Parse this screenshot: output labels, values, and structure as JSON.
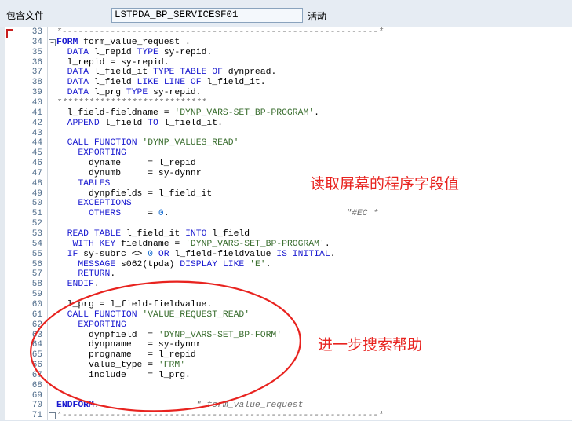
{
  "header": {
    "package_label": "包含文件",
    "include_name": "LSTPDA_BP_SERVICESF01",
    "status": "活动"
  },
  "annotations": {
    "read_screen_values": "读取屏幕的程序字段值",
    "search_help": "进一步搜索帮助"
  },
  "colors": {
    "annotation": "#e8231f",
    "keyword": "#1a1ad0",
    "string": "#3a6e2f",
    "line_number": "#4e6b8a"
  },
  "code_lines": [
    {
      "n": "33",
      "fold": "",
      "segs": [
        {
          "t": "*-----------------------------------------------------------*",
          "c": "cmt"
        }
      ]
    },
    {
      "n": "34",
      "fold": "⊟",
      "segs": [
        {
          "t": "FORM",
          "c": "kw bold"
        },
        {
          "t": " form_value_request .",
          "c": ""
        }
      ]
    },
    {
      "n": "35",
      "fold": "",
      "segs": [
        {
          "t": "  DATA",
          "c": "kw"
        },
        {
          "t": " l_repid ",
          "c": ""
        },
        {
          "t": "TYPE",
          "c": "kw"
        },
        {
          "t": " sy-repid.",
          "c": ""
        }
      ]
    },
    {
      "n": "36",
      "fold": "",
      "segs": [
        {
          "t": "  l_repid = sy-repid.",
          "c": ""
        }
      ]
    },
    {
      "n": "37",
      "fold": "",
      "segs": [
        {
          "t": "  DATA",
          "c": "kw"
        },
        {
          "t": " l_field_it ",
          "c": ""
        },
        {
          "t": "TYPE TABLE OF",
          "c": "kw"
        },
        {
          "t": " dynpread.",
          "c": ""
        }
      ]
    },
    {
      "n": "38",
      "fold": "",
      "segs": [
        {
          "t": "  DATA",
          "c": "kw"
        },
        {
          "t": " l_field ",
          "c": ""
        },
        {
          "t": "LIKE LINE OF",
          "c": "kw"
        },
        {
          "t": " l_field_it.",
          "c": ""
        }
      ]
    },
    {
      "n": "39",
      "fold": "",
      "segs": [
        {
          "t": "  DATA",
          "c": "kw"
        },
        {
          "t": " l_prg ",
          "c": ""
        },
        {
          "t": "TYPE",
          "c": "kw"
        },
        {
          "t": " sy-repid.",
          "c": ""
        }
      ]
    },
    {
      "n": "40",
      "fold": "",
      "segs": [
        {
          "t": "****************************",
          "c": "cmt"
        }
      ]
    },
    {
      "n": "41",
      "fold": "",
      "segs": [
        {
          "t": "  l_field-fieldname = ",
          "c": ""
        },
        {
          "t": "'DYNP_VARS-SET_BP-PROGRAM'",
          "c": "str"
        },
        {
          "t": ".",
          "c": ""
        }
      ]
    },
    {
      "n": "42",
      "fold": "",
      "segs": [
        {
          "t": "  APPEND",
          "c": "kw"
        },
        {
          "t": " l_field ",
          "c": ""
        },
        {
          "t": "TO",
          "c": "kw"
        },
        {
          "t": " l_field_it.",
          "c": ""
        }
      ]
    },
    {
      "n": "43",
      "fold": "",
      "segs": []
    },
    {
      "n": "44",
      "fold": "",
      "segs": [
        {
          "t": "  CALL FUNCTION",
          "c": "kw"
        },
        {
          "t": " ",
          "c": ""
        },
        {
          "t": "'DYNP_VALUES_READ'",
          "c": "str"
        }
      ]
    },
    {
      "n": "45",
      "fold": "",
      "segs": [
        {
          "t": "    EXPORTING",
          "c": "kw"
        }
      ]
    },
    {
      "n": "46",
      "fold": "",
      "segs": [
        {
          "t": "      dyname     = l_repid",
          "c": ""
        }
      ]
    },
    {
      "n": "47",
      "fold": "",
      "segs": [
        {
          "t": "      dynumb     = sy-dynnr",
          "c": ""
        }
      ]
    },
    {
      "n": "48",
      "fold": "",
      "segs": [
        {
          "t": "    TABLES",
          "c": "kw"
        }
      ]
    },
    {
      "n": "49",
      "fold": "",
      "segs": [
        {
          "t": "      dynpfields = l_field_it",
          "c": ""
        }
      ]
    },
    {
      "n": "50",
      "fold": "",
      "segs": [
        {
          "t": "    EXCEPTIONS",
          "c": "kw"
        }
      ]
    },
    {
      "n": "51",
      "fold": "",
      "segs": [
        {
          "t": "      OTHERS",
          "c": "kw"
        },
        {
          "t": "     = ",
          "c": ""
        },
        {
          "t": "0",
          "c": "num-lit"
        },
        {
          "t": ".                                 ",
          "c": ""
        },
        {
          "t": "\"#EC *",
          "c": "cmt"
        }
      ]
    },
    {
      "n": "52",
      "fold": "",
      "segs": []
    },
    {
      "n": "53",
      "fold": "",
      "segs": [
        {
          "t": "  READ TABLE",
          "c": "kw"
        },
        {
          "t": " l_field_it ",
          "c": ""
        },
        {
          "t": "INTO",
          "c": "kw"
        },
        {
          "t": " l_field",
          "c": ""
        }
      ]
    },
    {
      "n": "54",
      "fold": "",
      "segs": [
        {
          "t": "   WITH KEY",
          "c": "kw"
        },
        {
          "t": " fieldname = ",
          "c": ""
        },
        {
          "t": "'DYNP_VARS-SET_BP-PROGRAM'",
          "c": "str"
        },
        {
          "t": ".",
          "c": ""
        }
      ]
    },
    {
      "n": "55",
      "fold": "",
      "segs": [
        {
          "t": "  IF",
          "c": "kw"
        },
        {
          "t": " sy-subrc <> ",
          "c": ""
        },
        {
          "t": "0",
          "c": "num-lit"
        },
        {
          "t": " ",
          "c": ""
        },
        {
          "t": "OR",
          "c": "kw"
        },
        {
          "t": " l_field-fieldvalue ",
          "c": ""
        },
        {
          "t": "IS INITIAL",
          "c": "kw"
        },
        {
          "t": ".",
          "c": ""
        }
      ]
    },
    {
      "n": "56",
      "fold": "",
      "segs": [
        {
          "t": "    MESSAGE",
          "c": "kw"
        },
        {
          "t": " s062(tpda) ",
          "c": ""
        },
        {
          "t": "DISPLAY LIKE",
          "c": "kw"
        },
        {
          "t": " ",
          "c": ""
        },
        {
          "t": "'E'",
          "c": "str"
        },
        {
          "t": ".",
          "c": ""
        }
      ]
    },
    {
      "n": "57",
      "fold": "",
      "segs": [
        {
          "t": "    RETURN",
          "c": "kw"
        },
        {
          "t": ".",
          "c": ""
        }
      ]
    },
    {
      "n": "58",
      "fold": "",
      "segs": [
        {
          "t": "  ENDIF",
          "c": "kw"
        },
        {
          "t": ".",
          "c": ""
        }
      ]
    },
    {
      "n": "59",
      "fold": "",
      "segs": []
    },
    {
      "n": "60",
      "fold": "",
      "segs": [
        {
          "t": "  l_prg = l_field-fieldvalue.",
          "c": ""
        }
      ]
    },
    {
      "n": "61",
      "fold": "",
      "segs": [
        {
          "t": "  CALL FUNCTION",
          "c": "kw"
        },
        {
          "t": " ",
          "c": ""
        },
        {
          "t": "'VALUE_REQUEST_READ'",
          "c": "str"
        }
      ]
    },
    {
      "n": "62",
      "fold": "",
      "segs": [
        {
          "t": "    EXPORTING",
          "c": "kw"
        }
      ]
    },
    {
      "n": "63",
      "fold": "",
      "segs": [
        {
          "t": "      dynpfield  = ",
          "c": ""
        },
        {
          "t": "'DYNP_VARS-SET_BP-FORM'",
          "c": "str"
        }
      ]
    },
    {
      "n": "64",
      "fold": "",
      "segs": [
        {
          "t": "      dynpname   = sy-dynnr",
          "c": ""
        }
      ]
    },
    {
      "n": "65",
      "fold": "",
      "segs": [
        {
          "t": "      progname   = l_repid",
          "c": ""
        }
      ]
    },
    {
      "n": "66",
      "fold": "",
      "segs": [
        {
          "t": "      value_type = ",
          "c": ""
        },
        {
          "t": "'FRM'",
          "c": "str"
        }
      ]
    },
    {
      "n": "67",
      "fold": "",
      "segs": [
        {
          "t": "      include    = l_prg.",
          "c": ""
        }
      ]
    },
    {
      "n": "68",
      "fold": "",
      "segs": []
    },
    {
      "n": "69",
      "fold": "",
      "segs": []
    },
    {
      "n": "70",
      "fold": "",
      "segs": [
        {
          "t": "ENDFORM",
          "c": "kw bold"
        },
        {
          "t": ".                  ",
          "c": ""
        },
        {
          "t": "\" form_value_request",
          "c": "cmt"
        }
      ]
    },
    {
      "n": "71",
      "fold": "⊟",
      "segs": [
        {
          "t": "*-----------------------------------------------------------*",
          "c": "cmt"
        }
      ]
    }
  ]
}
